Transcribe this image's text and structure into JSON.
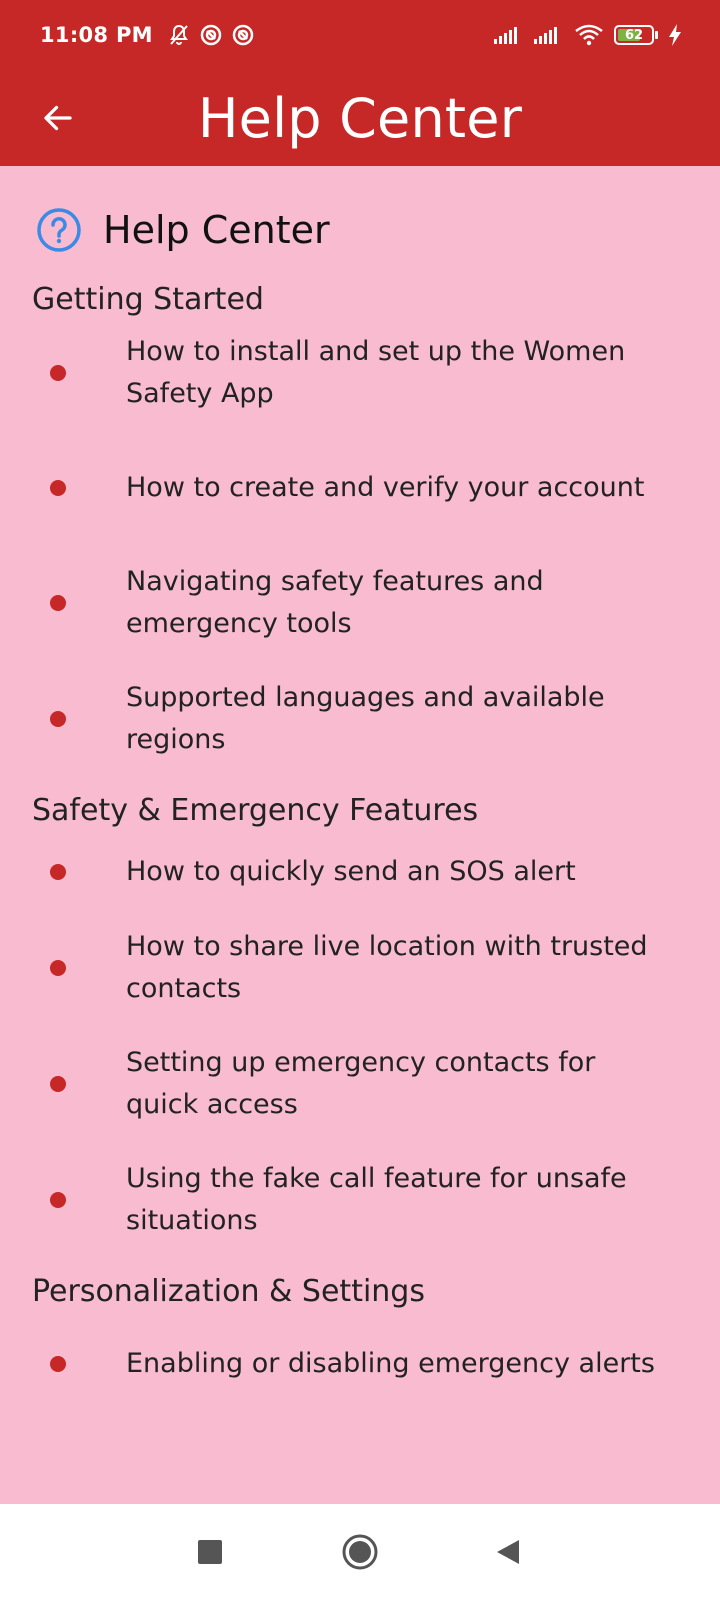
{
  "status_bar": {
    "time": "11:08 PM",
    "battery": "62",
    "icons": [
      "bell-off-icon",
      "ring-icon",
      "ring-icon",
      "signal-icon",
      "signal-icon",
      "wifi-icon",
      "battery-icon",
      "charging-bolt-icon"
    ]
  },
  "app_bar": {
    "title": "Help Center",
    "back_icon": "arrow-back-icon"
  },
  "page": {
    "title": "Help Center",
    "icon": "help-circle-icon"
  },
  "sections": [
    {
      "title": "Getting Started",
      "items": [
        "How to install and set up the Women Safety App",
        "How to create and verify your account",
        "Navigating safety features and emergency tools",
        "Supported languages and available regions"
      ]
    },
    {
      "title": "Safety & Emergency Features",
      "items": [
        "How to quickly send an SOS alert",
        "How to share live location with trusted contacts",
        "Setting up emergency contacts for quick access",
        "Using the fake call feature for unsafe situations"
      ]
    },
    {
      "title": "Personalization & Settings",
      "items": [
        "Enabling or disabling emergency alerts"
      ]
    }
  ],
  "nav_bar": {
    "icons": [
      "square-recent-icon",
      "circle-home-icon",
      "triangle-back-icon"
    ]
  },
  "colors": {
    "primary": "#c62828",
    "background": "#f8bbd0",
    "help_icon": "#3b8ae6"
  }
}
